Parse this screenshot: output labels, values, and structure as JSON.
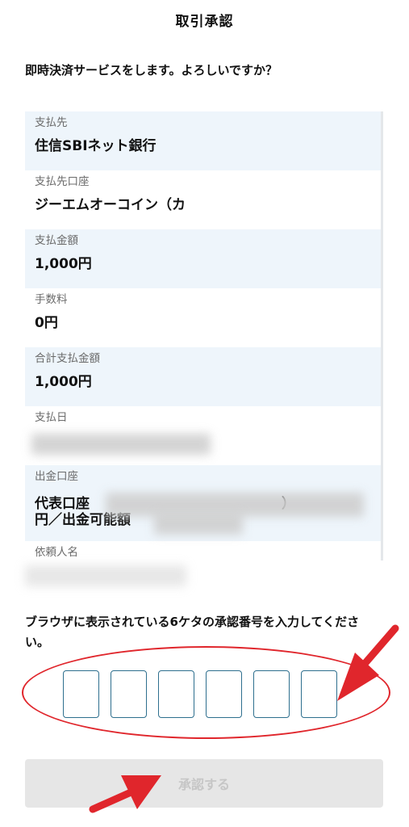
{
  "header": {
    "title": "取引承認"
  },
  "question": "即時決済サービスをします。よろしいですか？",
  "details": [
    {
      "label": "支払先",
      "value": "住信SBIネット銀行"
    },
    {
      "label": "支払先口座",
      "value": "ジーエムオーコイン（カ"
    },
    {
      "label": "支払金額",
      "value": "1,000円"
    },
    {
      "label": "手数料",
      "value": "0円"
    },
    {
      "label": "合計支払金額",
      "value": "1,000円"
    },
    {
      "label": "支払日",
      "value": ""
    },
    {
      "label": "出金口座",
      "value": "代表口座　　　　　　　　　　　　　　）\n円／出金可能額"
    },
    {
      "label": "依頼人名",
      "value": ""
    }
  ],
  "instruction": "ブラウザに表示されている6ケタの承認番号を入力してください。",
  "code_boxes": 6,
  "approve_button": {
    "label": "承認する"
  },
  "colors": {
    "shaded_row": "#eef5fb",
    "code_box_border": "#2e6f8e",
    "annotation_red": "#e0262c",
    "button_disabled_bg": "#e6e6e6",
    "button_disabled_text": "#c6c6c6"
  }
}
